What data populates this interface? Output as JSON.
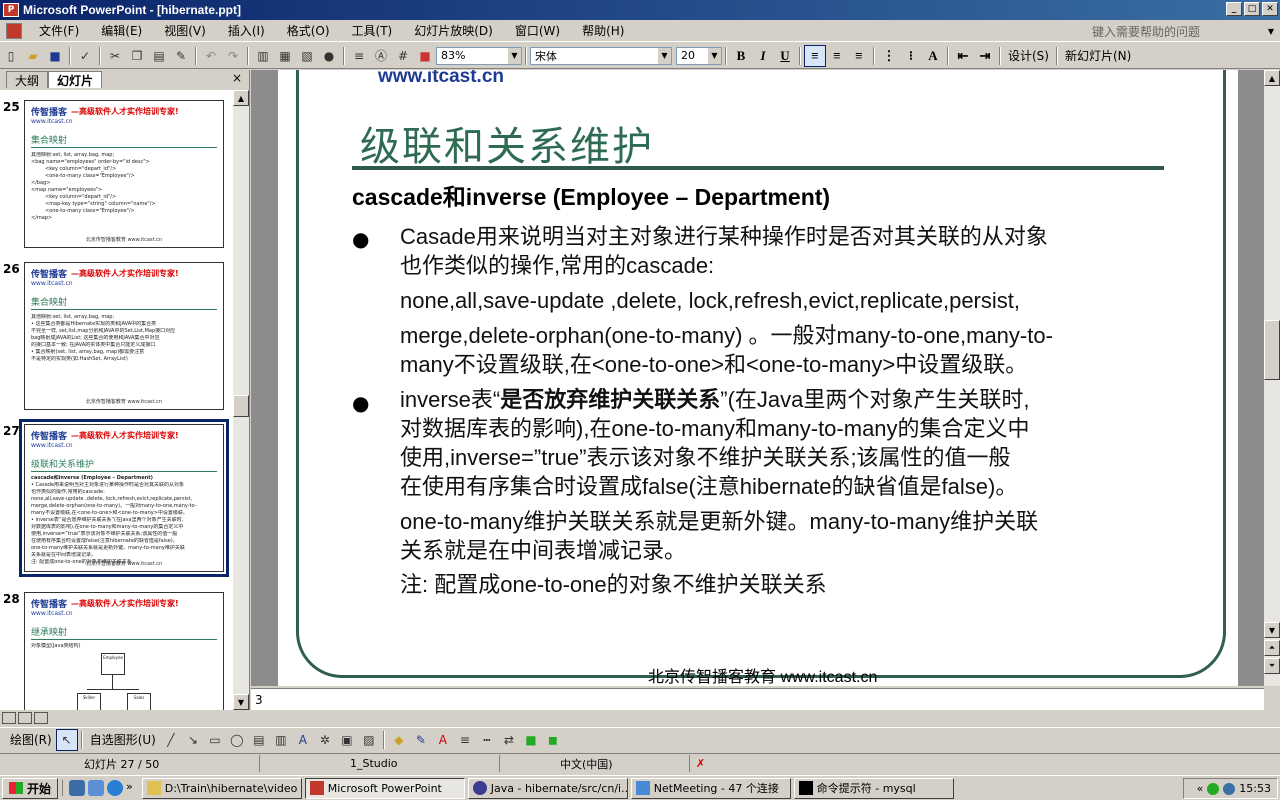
{
  "window": {
    "title": "Microsoft PowerPoint - [hibernate.ppt]",
    "controls": [
      "_",
      "□",
      "✕"
    ]
  },
  "menu": {
    "items": [
      "文件(F)",
      "编辑(E)",
      "视图(V)",
      "插入(I)",
      "格式(O)",
      "工具(T)",
      "幻灯片放映(D)",
      "窗口(W)",
      "帮助(H)"
    ],
    "help_placeholder": "键入需要帮助的问题"
  },
  "toolbar": {
    "zoom": "83%",
    "font_name": "宋体",
    "font_size": "20",
    "design_label": "设计(S)",
    "new_slide_label": "新幻灯片(N)"
  },
  "left_pane": {
    "tab_outline": "大纲",
    "tab_slides": "幻灯片",
    "close": "×",
    "thumbnails": [
      {
        "number": "25",
        "logo": "传智播客",
        "slogan": "—高级软件人才实作培训专家!",
        "site": "www.itcast.cn",
        "title": "集合映射",
        "lines": [
          "其他映射:set, list, array,bag, map;",
          "<bag name=\"employees\" order-by=\"id desc\">",
          "<key column=\"depart_id\"/>",
          "<one-to-many class=\"Employee\"/>",
          "</bag>",
          "<map name=\"employees\">",
          "<key column=\"depart_id\"/>",
          "<map-key type=\"string\" column=\"name\"/>",
          "<one-to-many class=\"Employee\"/>",
          "</map>"
        ],
        "footer": "北京传智播客教育 www.itcast.cn"
      },
      {
        "number": "26",
        "logo": "传智播客",
        "slogan": "—高级软件人才实作培训专家!",
        "site": "www.itcast.cn",
        "title": "集合映射",
        "lines": [
          "其他映射:set, list, array,bag, map;",
          "• 这些集合类都是Hibernate实现的类和JAVA中的集合类",
          "  不完全一样, set,list,map分别和JAVA中的Set,List,Map接口对应",
          "  bag映射成JAVA的List; 这些集合的使用和JAVA集合中对应",
          "  的接口基本一致; 在JAVA的实体类中集合只能定义成接口",
          "• 集合映射(set, list, array,bag, map)都需要注意",
          "  不是特定的实现类(如:HashSet, ArrayList)"
        ],
        "footer": "北京传智播客教育 www.itcast.cn"
      },
      {
        "number": "27",
        "logo": "传智播客",
        "slogan": "—高级软件人才实作培训专家!",
        "site": "www.itcast.cn",
        "title": "级联和关系维护",
        "lines": [
          "cascade和inverse (Employee – Department)",
          "• Casade用来说明当对主对象进行某种操作时是否对其关联的从对象",
          "  也作类似的操作,常用的cascade:",
          "  none,all,save-update ,delete, lock,refresh,evict,replicate,persist,",
          "  merge,delete-orphan(one-to-many)。一般对many-to-one,many-to-",
          "  many不设置级联,在<one-to-one>和<one-to-many>中设置级联。",
          "• inverse表“是否放弃维护关联关系”(在Java里两个对象产生关联时,",
          "  对数据库表的影响),在one-to-many和many-to-many的集合定义中",
          "  使用,inverse=”true”表示该对象不维护关联关系;该属性的值一般",
          "  在使用有序集合时设置成false(注意hibernate的缺省值是false)。",
          "  one-to-many维护关联关系就是更新外键。many-to-many维护关联",
          "  关系就是在中间表增减记录。",
          "  注: 配置成one-to-one的对象不维护关联关系"
        ],
        "footer": "北京传智播客教育 www.itcast.cn"
      },
      {
        "number": "28",
        "logo": "传智播客",
        "slogan": "—高级软件人才实作培训专家!",
        "site": "www.itcast.cn",
        "title": "继承映射",
        "lines": [
          "对象模型(Java类结构)"
        ],
        "diagram_labels": [
          "Employee",
          "Skiller",
          "Sales"
        ],
        "footer": ""
      }
    ]
  },
  "slide": {
    "site_top": "www.itcast.cn",
    "title": "级联和关系维护",
    "subtitle": "cascade和inverse (Employee – Department)",
    "bullet_glyph": "●",
    "p1_l1": "Casade用来说明当对主对象进行某种操作时是否对其关联的从对象",
    "p1_l2": "也作类似的操作,常用的cascade:",
    "p1_l3": "none,all,save-update ,delete, lock,refresh,evict,replicate,persist,",
    "p1_l4": "merge,delete-orphan(one-to-many) 。一般对many-to-one,many-to-",
    "p1_l5": "many不设置级联,在<one-to-one>和<one-to-many>中设置级联。",
    "p2_l1_pre": "inverse表“",
    "p2_l1_bold": "是否放弃维护关联关系",
    "p2_l1_post": "”(在Java里两个对象产生关联时,",
    "p2_l2": "对数据库表的影响),在one-to-many和many-to-many的集合定义中",
    "p2_l3": "使用,inverse=”true”表示该对象不维护关联关系;该属性的值一般",
    "p2_l4": "在使用有序集合时设置成false(注意hibernate的缺省值是false)。",
    "p2_l5": "one-to-many维护关联关系就是更新外键。many-to-many维护关联",
    "p2_l6": "关系就是在中间表增减记录。",
    "p2_l7": "注: 配置成one-to-one的对象不维护关联关系",
    "footer": "北京传智播客教育 www.itcast.cn"
  },
  "notes": {
    "text": "3"
  },
  "draw_toolbar": {
    "draw_label": "绘图(R)",
    "autoshape_label": "自选图形(U)"
  },
  "status": {
    "slide_info": "幻灯片 27 / 50",
    "design": "1_Studio",
    "language": "中文(中国)"
  },
  "taskbar": {
    "start": "开始",
    "tasks": [
      "D:\\Train\\hibernate\\video",
      "Microsoft PowerPoint",
      "Java - hibernate/src/cn/i...",
      "NetMeeting - 47 个连接",
      "命令提示符 - mysql"
    ],
    "clock": "15:53",
    "expand": "«"
  }
}
